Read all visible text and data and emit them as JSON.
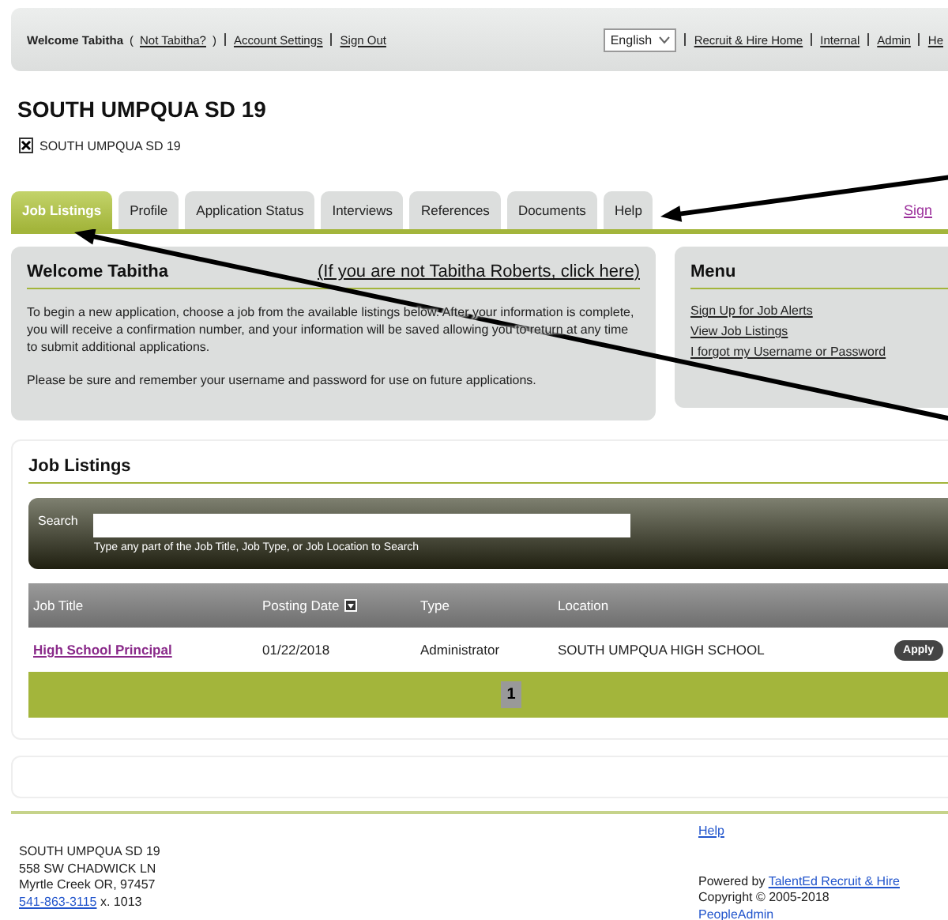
{
  "top_bar": {
    "welcome": "Welcome Tabitha",
    "not_user_link": "Not Tabitha?",
    "not_user_brackets": [
      "(",
      ")"
    ],
    "links_left": [
      "Account Settings",
      "Sign Out"
    ],
    "language": "English",
    "links_right": [
      "Recruit & Hire Home",
      "Internal",
      "Admin",
      "He"
    ]
  },
  "org": {
    "title": "SOUTH UMPQUA SD 19",
    "logo_alt": "SOUTH UMPQUA SD 19"
  },
  "tabs": [
    {
      "label": "Job Listings",
      "selected": true
    },
    {
      "label": "Profile",
      "selected": false
    },
    {
      "label": "Application Status",
      "selected": false
    },
    {
      "label": "Interviews",
      "selected": false
    },
    {
      "label": "References",
      "selected": false
    },
    {
      "label": "Documents",
      "selected": false
    },
    {
      "label": "Help",
      "selected": false
    }
  ],
  "tab_right_link": "Sign",
  "welcome_panel": {
    "title": "Welcome Tabitha",
    "link": "(If you are not Tabitha Roberts, click here)",
    "paragraphs": [
      "To begin a new application, choose a job from the available listings below. After your information is complete, you will receive a confirmation number, and your information will be saved allowing you to return at any time to submit additional applications.",
      "Please be sure and remember your username and password for use on future applications."
    ]
  },
  "menu_panel": {
    "title": "Menu",
    "links": [
      "Sign Up for Job Alerts",
      "View Job Listings",
      "I forgot my Username or Password"
    ]
  },
  "job_listings": {
    "title": "Job Listings",
    "search_label": "Search",
    "search_hint": "Type any part of the Job Title, Job Type, or Job Location to Search",
    "columns": [
      {
        "label": "Job Title",
        "sortable": false
      },
      {
        "label": "Posting Date",
        "sortable": true
      },
      {
        "label": "Type",
        "sortable": false
      },
      {
        "label": "Location",
        "sortable": false
      }
    ],
    "rows": [
      {
        "title": "High School Principal",
        "date": "01/22/2018",
        "type": "Administrator",
        "location": "SOUTH UMPQUA HIGH SCHOOL",
        "action": "Apply"
      }
    ],
    "pages": [
      {
        "label": "1",
        "selected": true
      }
    ]
  },
  "footer": {
    "address": [
      "SOUTH UMPQUA SD 19",
      "558 SW CHADWICK LN",
      "Myrtle Creek OR, 97457"
    ],
    "phone": "541-863-3115",
    "extension": "x. 1013",
    "help_link": "Help",
    "powered_by": "Powered by",
    "powered_link": "TalentEd Recruit & Hire",
    "copyright": "Copyright © 2005-2018",
    "company_link": "PeopleAdmin"
  }
}
